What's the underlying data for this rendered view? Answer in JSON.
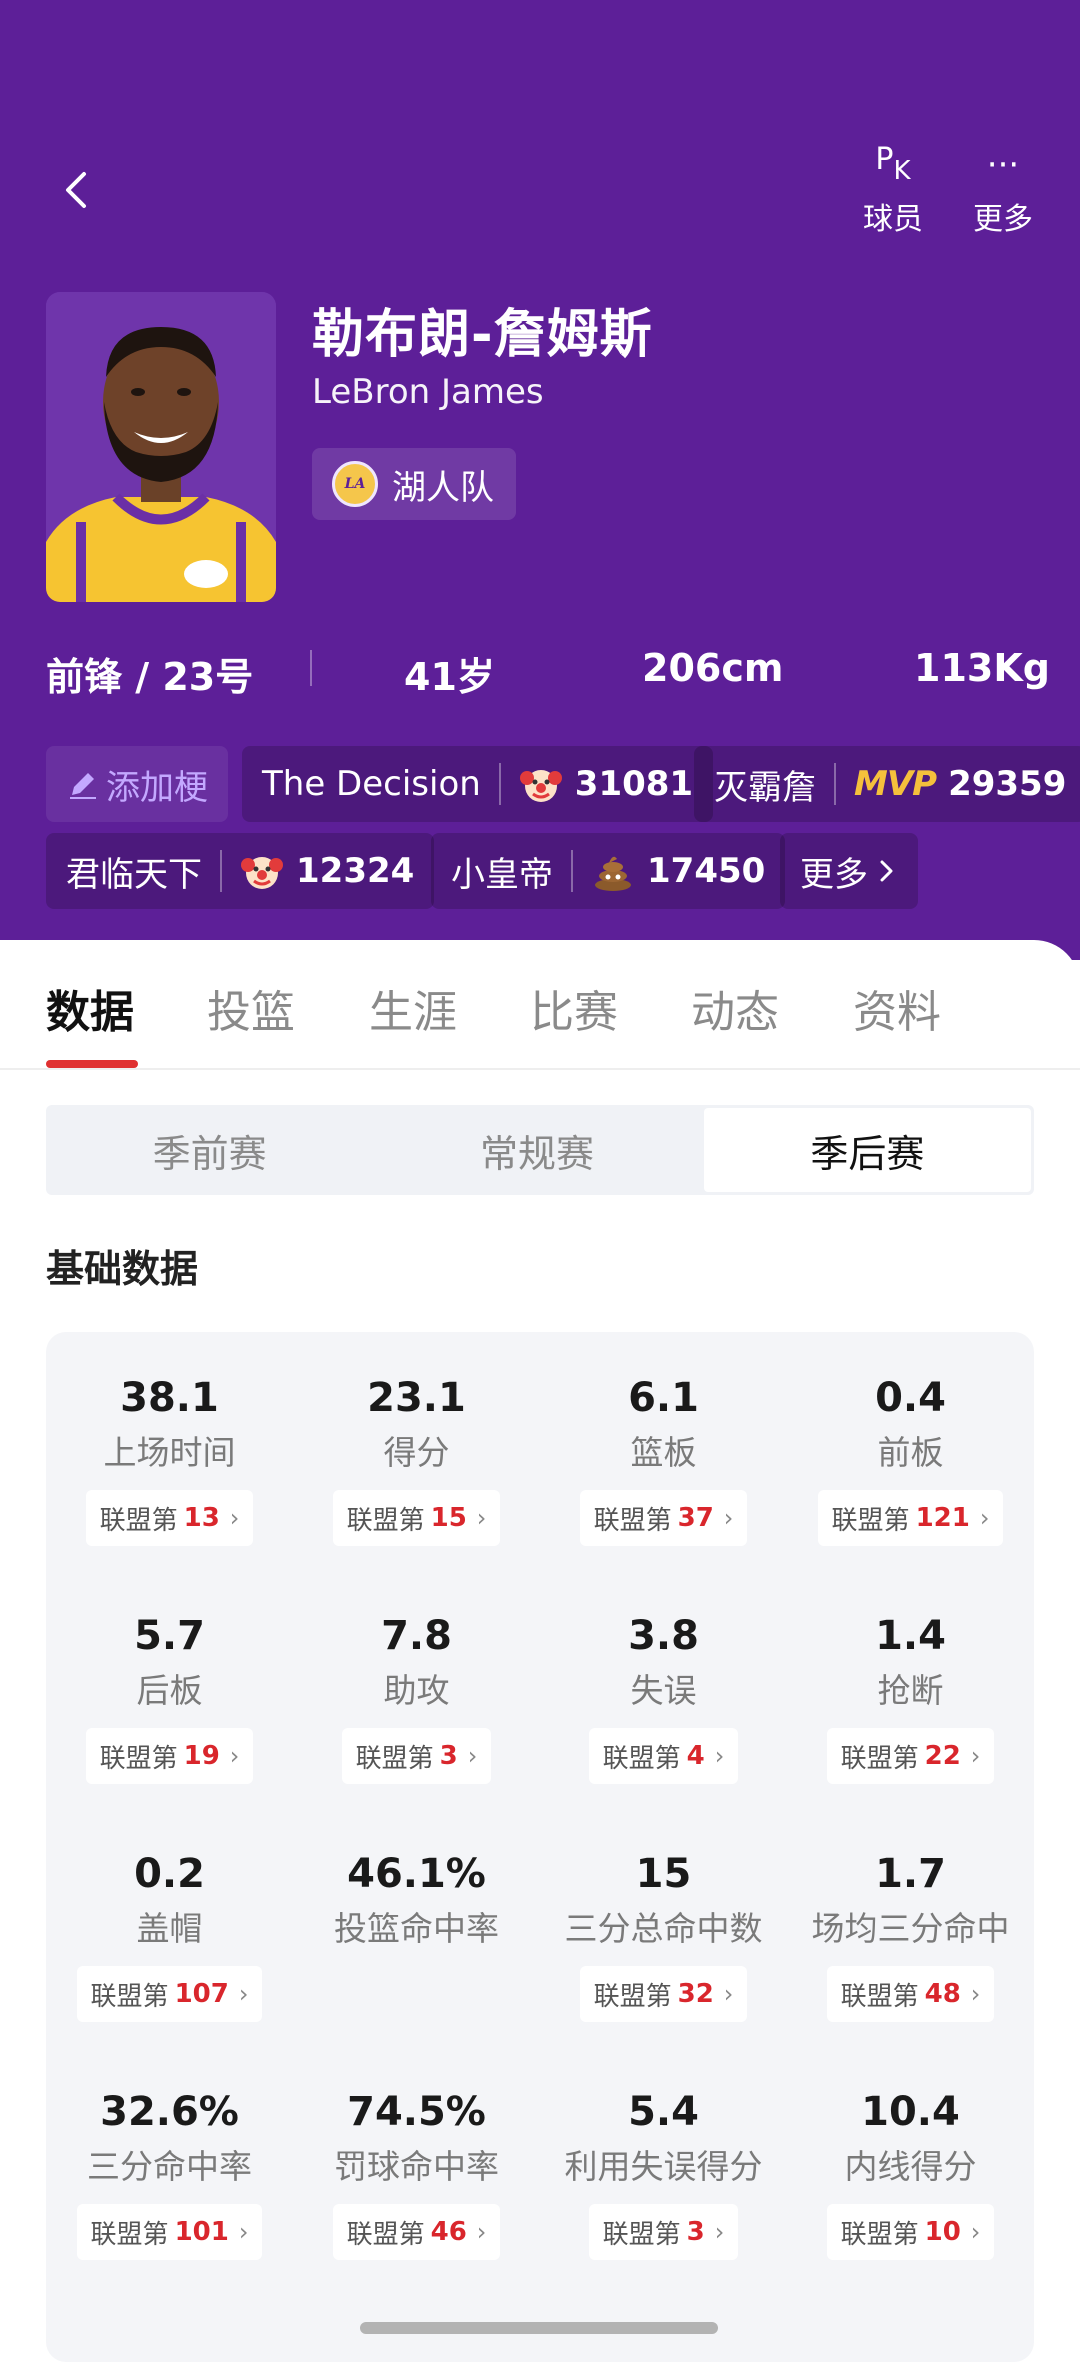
{
  "nav": {
    "pk_icon": "PK",
    "pk_label": "球员",
    "more_icon": "···",
    "more_label": "更多"
  },
  "player": {
    "name_cn": "勒布朗-詹姆斯",
    "name_en": "LeBron James",
    "team": "湖人队",
    "position_number": "前锋 / 23号",
    "age": "41岁",
    "height": "206cm",
    "weight": "113Kg"
  },
  "tags": {
    "add_label": "添加梗",
    "items": [
      {
        "text": "The Decision",
        "icon": "clown-emoji",
        "count": "31081"
      },
      {
        "text": "灭霸詹",
        "icon": "mvp-badge",
        "icon_text": "MVP",
        "count": "29359"
      },
      {
        "text": "君临天下",
        "icon": "clown-emoji",
        "count": "12324"
      },
      {
        "text": "小皇帝",
        "icon": "poop-emoji",
        "count": "17450"
      }
    ],
    "more_label": "更多"
  },
  "tabs": [
    "数据",
    "投篮",
    "生涯",
    "比赛",
    "动态",
    "资料"
  ],
  "season_types": [
    "季前赛",
    "常规赛",
    "季后赛"
  ],
  "section_title": "基础数据",
  "rank_prefix": "联盟第",
  "stats": [
    {
      "value": "38.1",
      "label": "上场时间",
      "rank": "13"
    },
    {
      "value": "23.1",
      "label": "得分",
      "rank": "15"
    },
    {
      "value": "6.1",
      "label": "篮板",
      "rank": "37"
    },
    {
      "value": "0.4",
      "label": "前板",
      "rank": "121"
    },
    {
      "value": "5.7",
      "label": "后板",
      "rank": "19"
    },
    {
      "value": "7.8",
      "label": "助攻",
      "rank": "3"
    },
    {
      "value": "3.8",
      "label": "失误",
      "rank": "4"
    },
    {
      "value": "1.4",
      "label": "抢断",
      "rank": "22"
    },
    {
      "value": "0.2",
      "label": "盖帽",
      "rank": "107"
    },
    {
      "value": "46.1%",
      "label": "投篮命中率",
      "rank": null
    },
    {
      "value": "15",
      "label": "三分总命中数",
      "rank": "32"
    },
    {
      "value": "1.7",
      "label": "场均三分命中",
      "rank": "48"
    },
    {
      "value": "32.6%",
      "label": "三分命中率",
      "rank": "101"
    },
    {
      "value": "74.5%",
      "label": "罚球命中率",
      "rank": "46"
    },
    {
      "value": "5.4",
      "label": "利用失误得分",
      "rank": "3"
    },
    {
      "value": "10.4",
      "label": "内线得分",
      "rank": "10"
    }
  ],
  "colors": {
    "header_bg": "#5d1f98",
    "accent_red": "#d9262c",
    "mvp_gold": "#f5c03c"
  }
}
